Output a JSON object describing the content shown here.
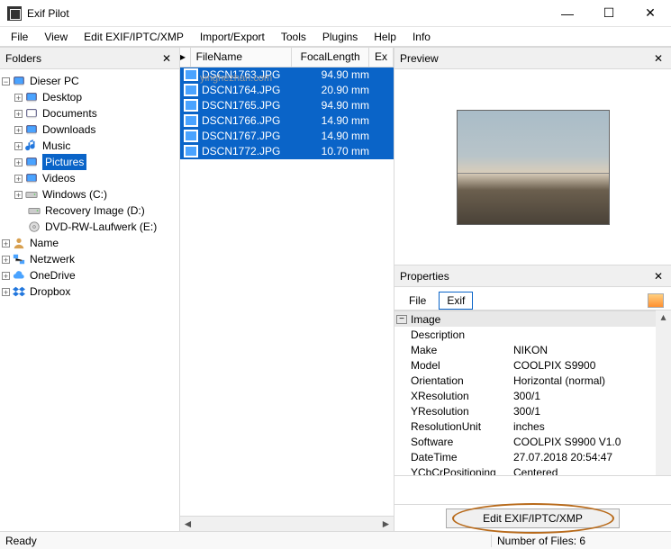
{
  "window": {
    "title": "Exif Pilot"
  },
  "menu": {
    "items": [
      "File",
      "View",
      "Edit EXIF/IPTC/XMP",
      "Import/Export",
      "Tools",
      "Plugins",
      "Help",
      "Info"
    ]
  },
  "folders": {
    "title": "Folders",
    "tree": [
      {
        "label": "Dieser PC",
        "depth": 1,
        "expand": "−",
        "icon": "pc"
      },
      {
        "label": "Desktop",
        "depth": 2,
        "expand": "+",
        "icon": "desktop"
      },
      {
        "label": "Documents",
        "depth": 2,
        "expand": "+",
        "icon": "doc"
      },
      {
        "label": "Downloads",
        "depth": 2,
        "expand": "+",
        "icon": "dl"
      },
      {
        "label": "Music",
        "depth": 2,
        "expand": "+",
        "icon": "music"
      },
      {
        "label": "Pictures",
        "depth": 2,
        "expand": "+",
        "icon": "pic",
        "selected": true
      },
      {
        "label": "Videos",
        "depth": 2,
        "expand": "+",
        "icon": "video"
      },
      {
        "label": "Windows (C:)",
        "depth": 2,
        "expand": "+",
        "icon": "drive"
      },
      {
        "label": "Recovery Image (D:)",
        "depth": 2,
        "expand": "",
        "icon": "drive"
      },
      {
        "label": "DVD-RW-Laufwerk (E:)",
        "depth": 2,
        "expand": "",
        "icon": "cd"
      },
      {
        "label": "Name",
        "depth": 1,
        "expand": "+",
        "icon": "user"
      },
      {
        "label": "Netzwerk",
        "depth": 1,
        "expand": "+",
        "icon": "net"
      },
      {
        "label": "OneDrive",
        "depth": 1,
        "expand": "+",
        "icon": "cloud"
      },
      {
        "label": "Dropbox",
        "depth": 1,
        "expand": "+",
        "icon": "dropbox"
      }
    ]
  },
  "files": {
    "columns": {
      "arrow": "▸",
      "name": "FileName",
      "focal": "FocalLength",
      "ex": "Ex"
    },
    "rows": [
      {
        "name": "DSCN1763.JPG",
        "focal": "94.90 mm"
      },
      {
        "name": "DSCN1764.JPG",
        "focal": "20.90 mm"
      },
      {
        "name": "DSCN1765.JPG",
        "focal": "94.90 mm"
      },
      {
        "name": "DSCN1766.JPG",
        "focal": "14.90 mm"
      },
      {
        "name": "DSCN1767.JPG",
        "focal": "14.90 mm"
      },
      {
        "name": "DSCN1772.JPG",
        "focal": "10.70 mm"
      }
    ],
    "watermark": "yinghezhan.com"
  },
  "preview": {
    "title": "Preview"
  },
  "properties": {
    "title": "Properties",
    "tabs": {
      "file": "File",
      "exif": "Exif"
    },
    "group": "Image",
    "rows": [
      {
        "k": "Description",
        "v": ""
      },
      {
        "k": "Make",
        "v": "NIKON"
      },
      {
        "k": "Model",
        "v": "COOLPIX S9900"
      },
      {
        "k": "Orientation",
        "v": "Horizontal (normal)"
      },
      {
        "k": "XResolution",
        "v": "300/1"
      },
      {
        "k": "YResolution",
        "v": "300/1"
      },
      {
        "k": "ResolutionUnit",
        "v": "inches"
      },
      {
        "k": "Software",
        "v": "COOLPIX S9900  V1.0"
      },
      {
        "k": "DateTime",
        "v": "27.07.2018 20:54:47"
      },
      {
        "k": "YCbCrPositioning",
        "v": "Centered"
      }
    ],
    "edit_button": "Edit EXIF/IPTC/XMP"
  },
  "status": {
    "left": "Ready",
    "right": "Number of Files: 6"
  }
}
